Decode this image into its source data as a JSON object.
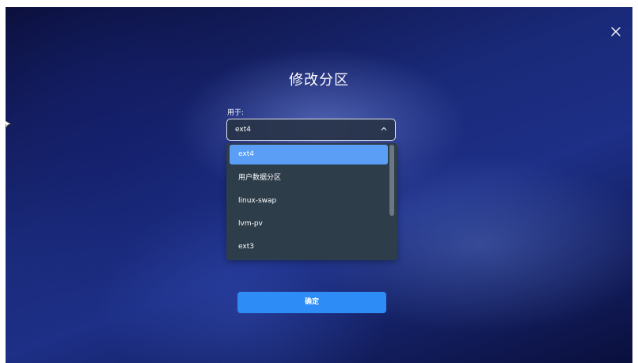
{
  "dialog": {
    "title": "修改分区",
    "close_icon": "close-icon"
  },
  "usage": {
    "label": "用于:",
    "selected_value": "ext4"
  },
  "dropdown": {
    "options": [
      {
        "label": "ext4",
        "selected": true
      },
      {
        "label": "用户数据分区",
        "selected": false
      },
      {
        "label": "linux-swap",
        "selected": false
      },
      {
        "label": "lvm-pv",
        "selected": false
      },
      {
        "label": "ext3",
        "selected": false
      }
    ]
  },
  "actions": {
    "confirm_label": "确定"
  },
  "colors": {
    "accent": "#2d8cf5",
    "selected_option": "#5a9ef5",
    "dropdown_bg": "#2d3d4a"
  }
}
